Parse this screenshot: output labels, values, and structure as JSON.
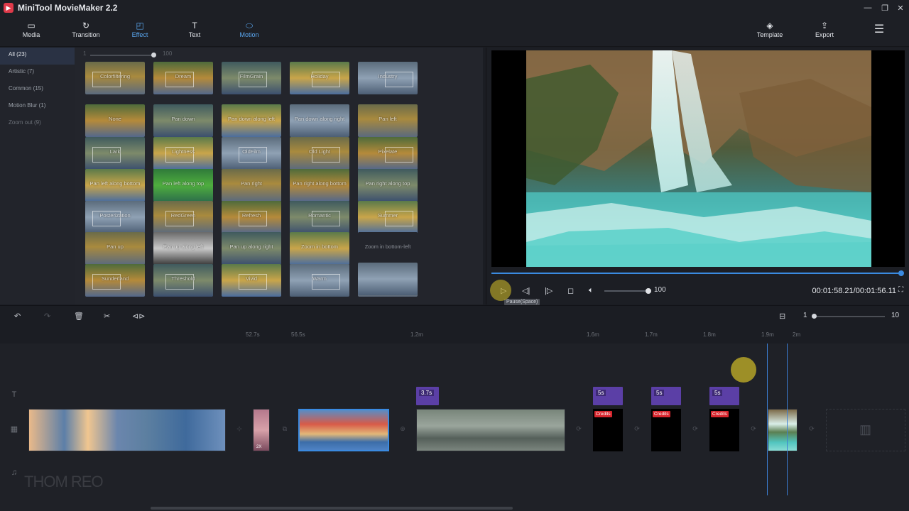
{
  "window": {
    "title": "MiniTool MovieMaker 2.2"
  },
  "toolbar": {
    "items": [
      {
        "label": "Media"
      },
      {
        "label": "Transition"
      },
      {
        "label": "Effect"
      },
      {
        "label": "Text"
      },
      {
        "label": "Motion"
      }
    ],
    "right": [
      {
        "label": "Template"
      },
      {
        "label": "Export"
      }
    ]
  },
  "categories": [
    {
      "label": "All (23)"
    },
    {
      "label": "Artistic (7)"
    },
    {
      "label": "Common (15)"
    },
    {
      "label": "Motion Blur (1)"
    },
    {
      "label": "Zoom out (9)"
    }
  ],
  "intensity": {
    "min": "1",
    "max": "100"
  },
  "effects": [
    [
      "Colorfiltering",
      "Dream",
      "FilmGrain",
      "Holiday",
      "Industry"
    ],
    [
      "None",
      "Pan down",
      "Pan down along left",
      "Pan down along right",
      "Pan left"
    ],
    [
      "Lark",
      "Lightness",
      "OldFilm",
      "Old Light",
      "Pixelate"
    ],
    [
      "Pan left along bottom",
      "Pan left along top",
      "Pan right",
      "Pan right along bottom",
      "Pan right along top"
    ],
    [
      "Posterization",
      "RedGreen",
      "Refresh",
      "Romantic",
      "Summer"
    ],
    [
      "Pan up",
      "Pan up along left",
      "Pan up along right",
      "Zoom in bottom",
      "Zoom in bottom-left"
    ],
    [
      "Sunderland",
      "Threshold",
      "Vivid",
      "Warm",
      ""
    ]
  ],
  "player": {
    "volume": "100",
    "timecode": "00:01:58.21/00:01:56.11",
    "tooltip": "Pause(Space)"
  },
  "zoom": {
    "min": "1",
    "max": "10"
  },
  "ruler": [
    "52.7s",
    "56.5s",
    "1.2m",
    "1.6m",
    "1.7m",
    "1.8m",
    "1.9m",
    "2m"
  ],
  "text_clips": [
    "3.7s",
    "5s",
    "5s",
    "5s"
  ],
  "credits": [
    "Credits",
    "Credits",
    "Credits"
  ],
  "clip_badge": "2X",
  "watermark": "THOM REO"
}
